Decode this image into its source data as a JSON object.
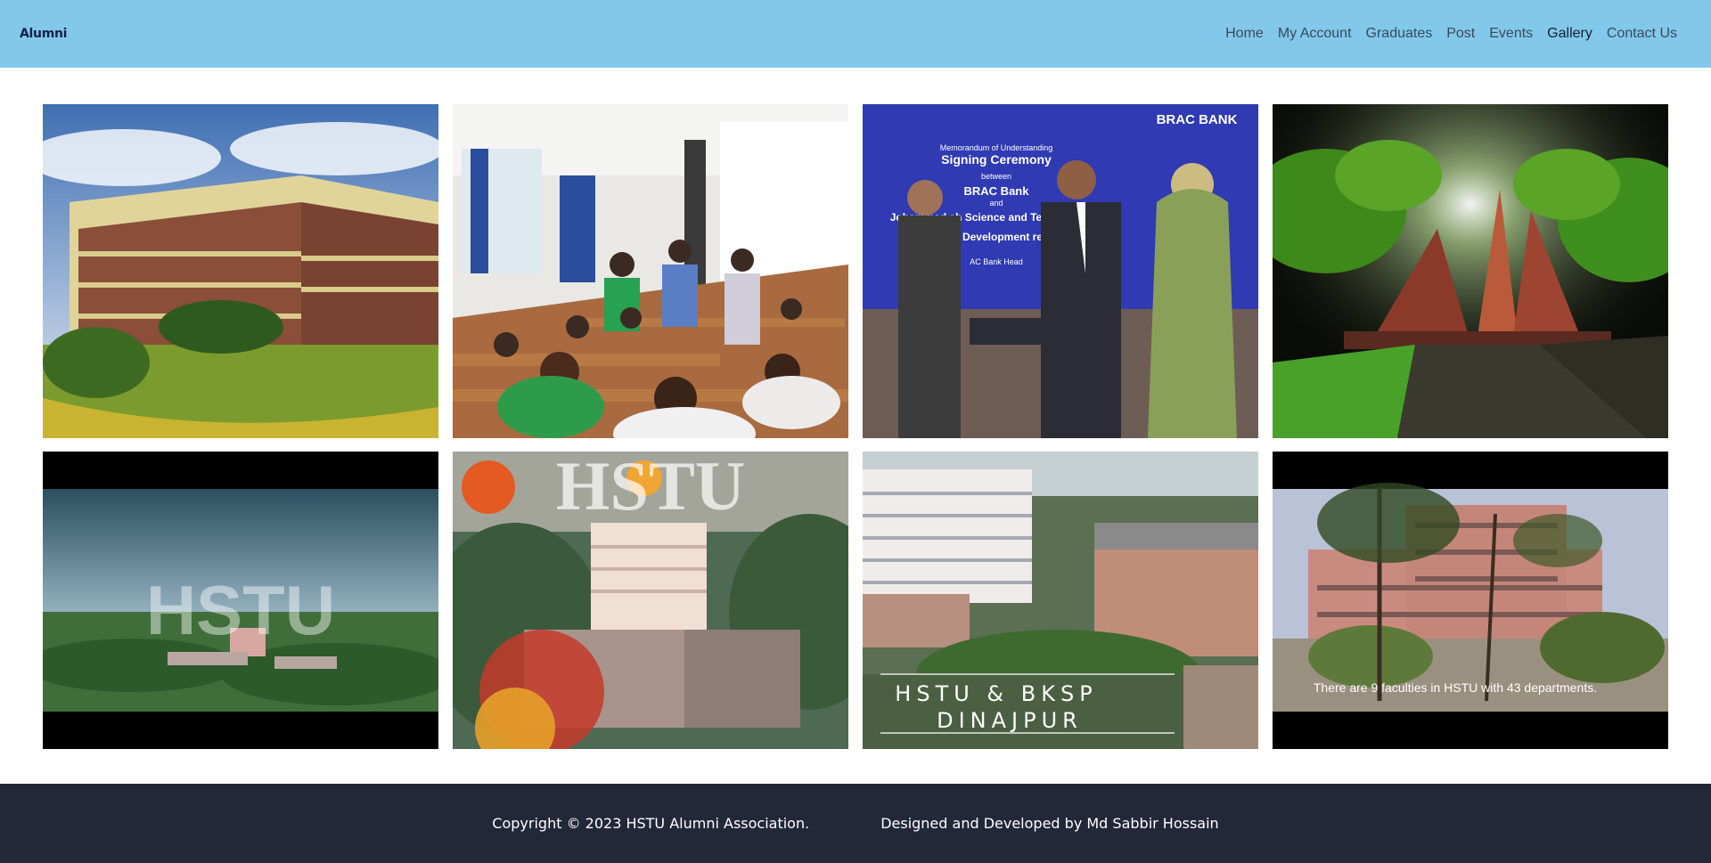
{
  "header": {
    "brand": "Alumni",
    "nav": [
      {
        "label": "Home"
      },
      {
        "label": "My Account"
      },
      {
        "label": "Graduates"
      },
      {
        "label": "Post"
      },
      {
        "label": "Events"
      },
      {
        "label": "Gallery",
        "active": true
      },
      {
        "label": "Contact Us"
      }
    ]
  },
  "gallery": {
    "photos": [
      {
        "id": "campus-building"
      },
      {
        "id": "exam-hall"
      },
      {
        "id": "brac-bank-mou",
        "text": {
          "brand": "BRAC BANK",
          "line1": "Memorandum of Understanding",
          "line2": "Signing Ceremony",
          "line3": "between",
          "line4": "BRAC Bank",
          "line5": "and",
          "line6": "Johammad  ah Science and Tec   University",
          "line7": "SR pro     Development         re Sect",
          "line8": "AC Bank Head"
        }
      },
      {
        "id": "monument-night"
      },
      {
        "id": "hstu-aerial-1",
        "text": "HSTU"
      },
      {
        "id": "hstu-aerial-2",
        "text": "HSTU"
      },
      {
        "id": "hstu-bksp",
        "text_line1": "HSTU & BKSP",
        "text_line2": "DINAJPUR"
      },
      {
        "id": "faculty-building",
        "caption": "There are 9 faculties in HSTU with 43 departments."
      }
    ]
  },
  "footer": {
    "copyright": "Copyright © 2023 HSTU Alumni Association.",
    "credit": "Designed and Developed by Md Sabbir Hossain"
  }
}
